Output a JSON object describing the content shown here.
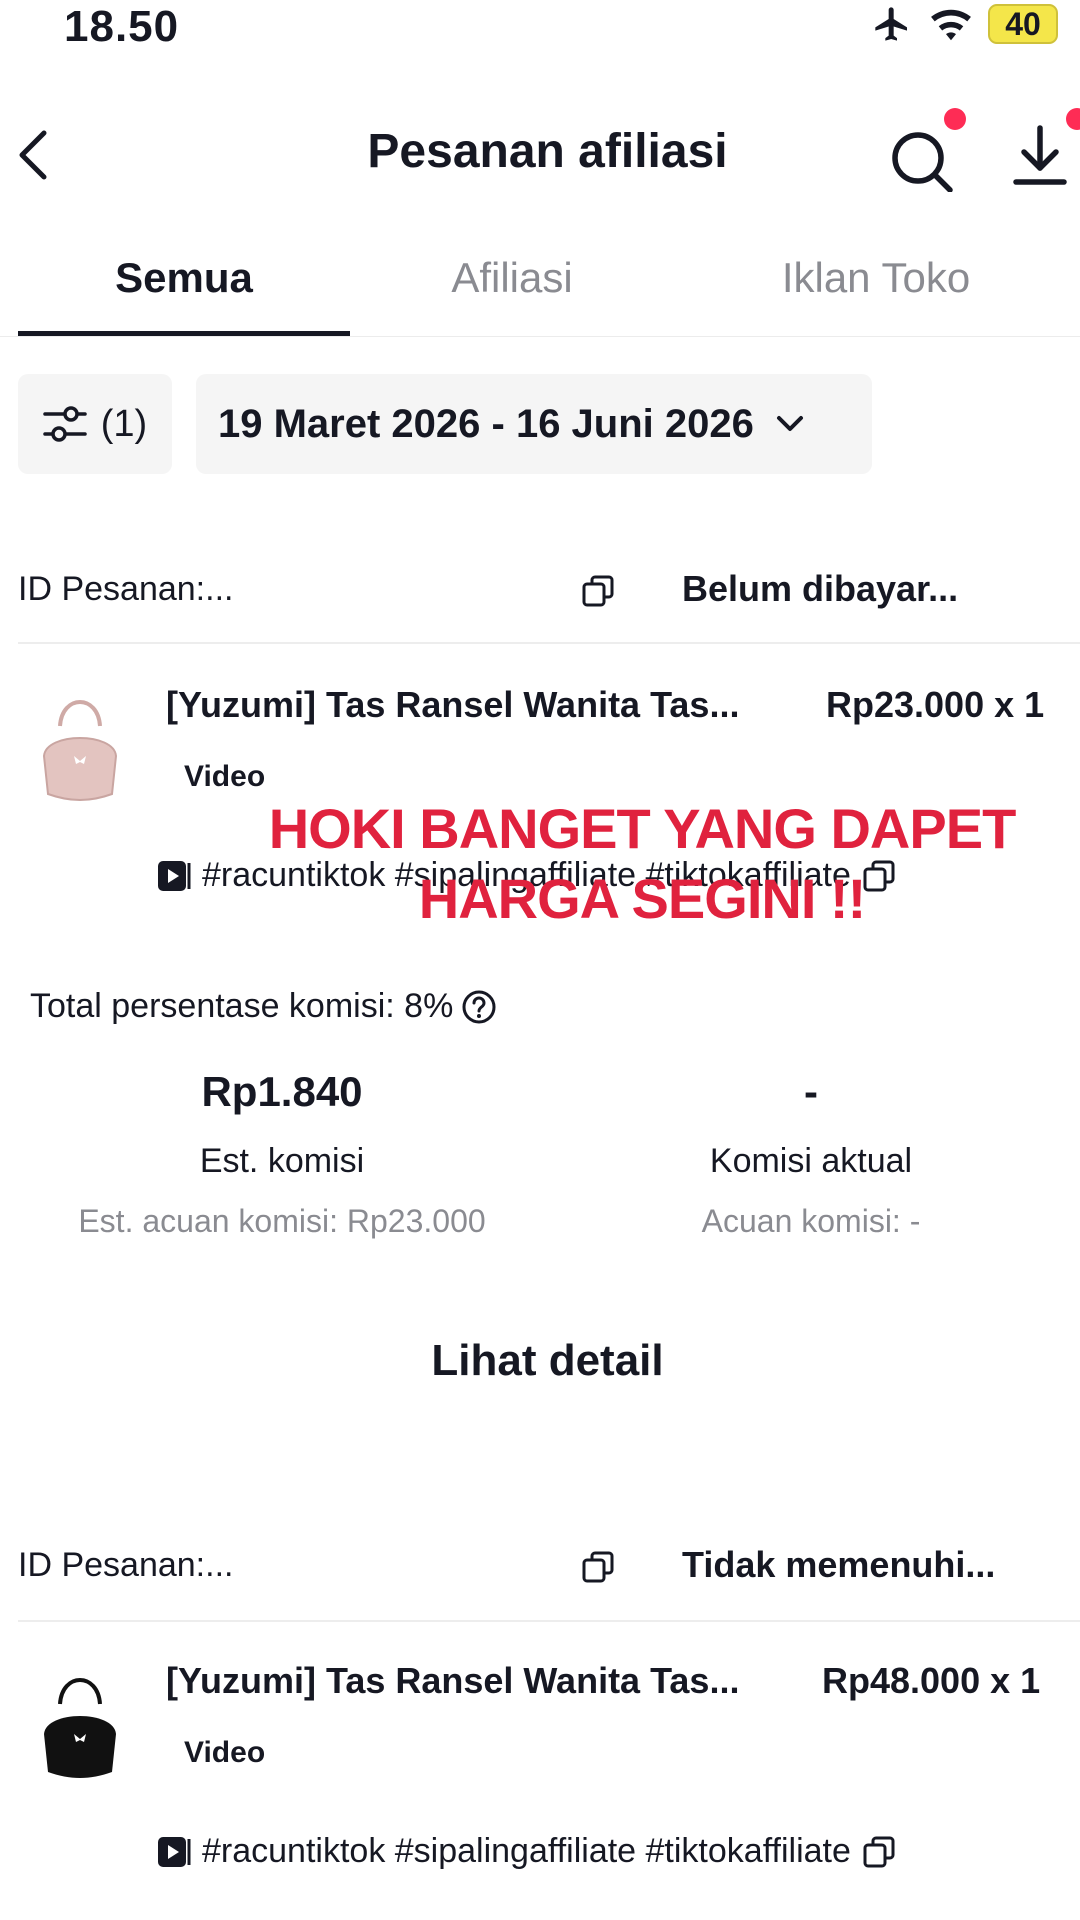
{
  "status_bar": {
    "time": "18.50",
    "battery": "40"
  },
  "header": {
    "title": "Pesanan afiliasi"
  },
  "tabs": [
    {
      "label": "Semua",
      "active": true
    },
    {
      "label": "Afiliasi",
      "active": false
    },
    {
      "label": "Iklan Toko",
      "active": false
    }
  ],
  "filters": {
    "filter_count": "(1)",
    "date_range": "19 Maret 2026 - 16 Juni 2026"
  },
  "orders": [
    {
      "id_label": "ID Pesanan:...",
      "status": "Belum dibayar...",
      "product_name": "[Yuzumi] Tas Ransel Wanita Tas...",
      "price": "Rp23.000 x 1",
      "source": "Video",
      "tags": "#racuntiktok #sipalingaffiliate #tiktokaffiliate",
      "image_color": "#e3c4c0",
      "commission_rate": "Total persentase komisi: 8%",
      "est_commission_value": "Rp1.840",
      "est_commission_label": "Est. komisi",
      "est_reference": "Est. acuan komisi: Rp23.000",
      "actual_commission_value": "-",
      "actual_commission_label": "Komisi aktual",
      "actual_reference": "Acuan komisi: -",
      "detail_link": "Lihat detail"
    },
    {
      "id_label": "ID Pesanan:...",
      "status": "Tidak memenuhi...",
      "product_name": "[Yuzumi] Tas Ransel Wanita Tas...",
      "price": "Rp48.000 x 1",
      "source": "Video",
      "tags": "#racuntiktok #sipalingaffiliate #tiktokaffiliate",
      "image_color": "#111111"
    }
  ],
  "overlay_caption": {
    "line1": "HOKI BANGET YANG DAPET",
    "line2": "HARGA SEGINI !!"
  },
  "colors": {
    "accent": "#fe2c55",
    "caption": "#e0223e",
    "muted": "#8a8b91"
  },
  "icons": [
    "back-icon",
    "search-icon",
    "download-icon",
    "filter-icon",
    "chevron-down-icon",
    "copy-icon",
    "play-icon",
    "help-icon",
    "airplane-icon",
    "wifi-icon",
    "battery-icon"
  ]
}
